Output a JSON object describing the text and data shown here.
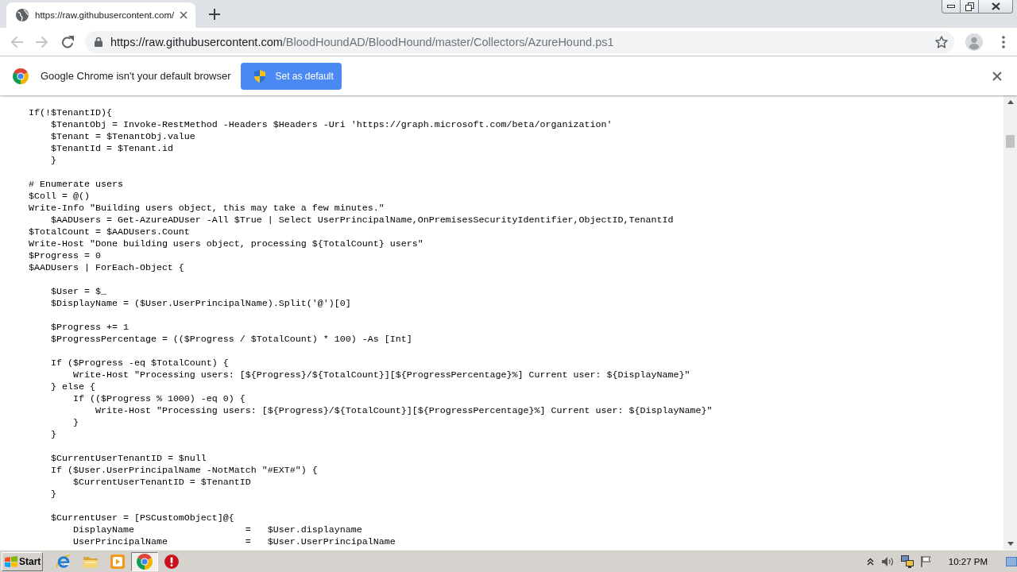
{
  "window": {
    "tabs": [
      {
        "title": "https://raw.githubusercontent.com/",
        "selected": true
      }
    ]
  },
  "toolbar": {
    "back": {
      "disabled": true
    },
    "forward": {
      "disabled": true
    },
    "address": {
      "host": "https://raw.githubusercontent.com",
      "path": "/BloodHoundAD/BloodHound/master/Collectors/AzureHound.ps1"
    }
  },
  "infobar": {
    "message": "Google Chrome isn't your default browser",
    "button": "Set as default"
  },
  "code_blocks": [
    [
      "If(!$TenantID){",
      "    $TenantObj = Invoke-RestMethod -Headers $Headers -Uri 'https://graph.microsoft.com/beta/organization'",
      "    $Tenant = $TenantObj.value",
      "    $TenantId = $Tenant.id",
      "    }"
    ],
    [
      "# Enumerate users",
      "$Coll = @()",
      "Write-Info \"Building users object, this may take a few minutes.\"",
      "    $AADUsers = Get-AzureADUser -All $True | Select UserPrincipalName,OnPremisesSecurityIdentifier,ObjectID,TenantId",
      "$TotalCount = $AADUsers.Count",
      "Write-Host \"Done building users object, processing ${TotalCount} users\"",
      "$Progress = 0",
      "$AADUsers | ForEach-Object {"
    ],
    [
      "    $User = $_",
      "    $DisplayName = ($User.UserPrincipalName).Split('@')[0]"
    ],
    [
      "    $Progress += 1",
      "    $ProgressPercentage = (($Progress / $TotalCount) * 100) -As [Int]"
    ],
    [
      "    If ($Progress -eq $TotalCount) {",
      "        Write-Host \"Processing users: [${Progress}/${TotalCount}][${ProgressPercentage}%] Current user: ${DisplayName}\"",
      "    } else {",
      "        If (($Progress % 1000) -eq 0) {",
      "            Write-Host \"Processing users: [${Progress}/${TotalCount}][${ProgressPercentage}%] Current user: ${DisplayName}\"",
      "        }",
      "    }"
    ],
    [
      "    $CurrentUserTenantID = $null",
      "    If ($User.UserPrincipalName -NotMatch \"#EXT#\") {",
      "        $CurrentUserTenantID = $TenantID",
      "    }"
    ],
    [
      "    $CurrentUser = [PSCustomObject]@{",
      "        DisplayName                    =   $User.displayname",
      "        UserPrincipalName              =   $User.UserPrincipalName"
    ]
  ],
  "taskbar": {
    "start": "Start",
    "apps": [
      {
        "kind": "letter",
        "selected": false
      },
      {
        "kind": "folder",
        "selected": false
      },
      {
        "kind": "player",
        "selected": false
      },
      {
        "kind": "tricolor",
        "selected": true
      },
      {
        "kind": "warning",
        "selected": false
      }
    ],
    "clock": "10:27 PM"
  }
}
